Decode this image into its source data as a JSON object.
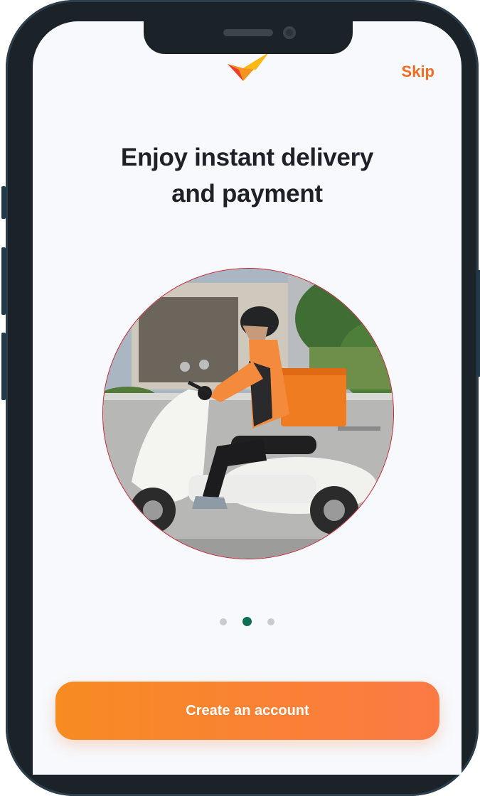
{
  "header": {
    "skip_label": "Skip"
  },
  "onboarding": {
    "title_line1": "Enjoy instant delivery",
    "title_line2": "and payment",
    "image_alt": "Courier on a white scooter with an orange delivery box",
    "pagination": {
      "total": 3,
      "active_index": 1
    }
  },
  "cta": {
    "label": "Create an account"
  },
  "colors": {
    "accent": "#f26b21",
    "button_start": "#f88b22",
    "button_end": "#fb7a45",
    "active_dot": "#0e6f56",
    "inactive_dot": "#c8ccd1",
    "title": "#1e2228",
    "image_border": "#c9202f"
  },
  "icons": {
    "logo": "checkmark-logo-icon"
  }
}
